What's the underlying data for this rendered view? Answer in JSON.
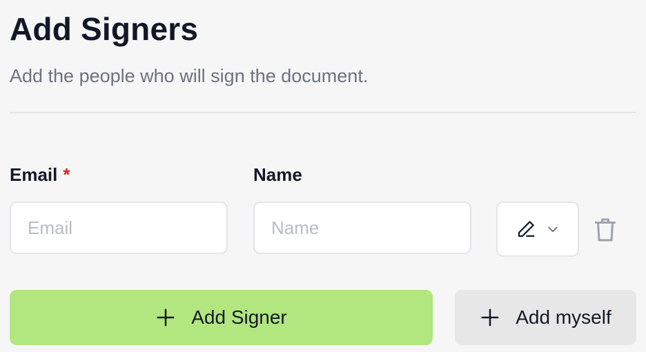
{
  "header": {
    "title": "Add Signers",
    "subtitle": "Add the people who will sign the document."
  },
  "form": {
    "email_label": "Email",
    "required_marker": "*",
    "name_label": "Name",
    "email_placeholder": "Email",
    "email_value": "",
    "name_placeholder": "Name",
    "name_value": "",
    "role_icon": "pen-icon",
    "delete_icon": "trash-icon"
  },
  "actions": {
    "add_signer_label": "Add Signer",
    "add_myself_label": "Add myself",
    "add_signer_color": "#b2e67f",
    "add_myself_color": "#e7e7e8"
  }
}
